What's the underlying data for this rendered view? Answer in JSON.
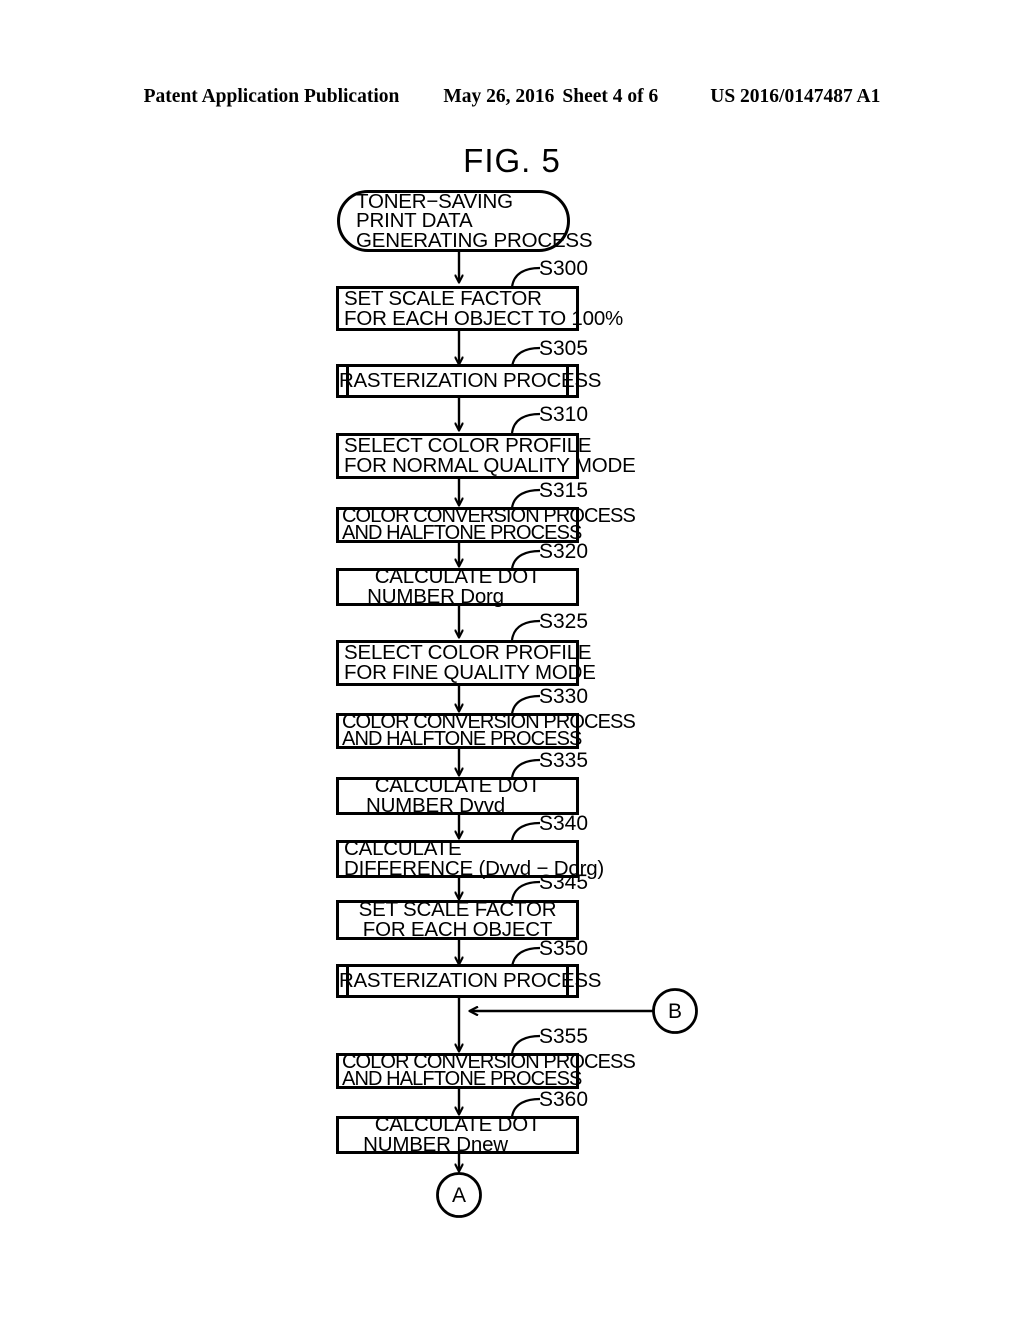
{
  "header": {
    "publication": "Patent Application Publication",
    "date": "May 26, 2016",
    "sheet": "Sheet 4 of 6",
    "patent_number": "US 2016/0147487 A1"
  },
  "figure": {
    "title": "FIG. 5"
  },
  "flowchart": {
    "start": {
      "label": "toner-saving-print-data-generating-process",
      "lines": [
        "TONER−SAVING",
        "PRINT DATA",
        "GENERATING PROCESS"
      ]
    },
    "steps": [
      {
        "id": "S300",
        "shape": "process",
        "align": "left",
        "lines": [
          "SET SCALE FACTOR",
          "FOR EACH OBJECT TO 100%"
        ]
      },
      {
        "id": "S305",
        "shape": "predefined-process",
        "align": "center",
        "lines": [
          "RASTERIZATION PROCESS"
        ]
      },
      {
        "id": "S310",
        "shape": "process",
        "align": "left",
        "lines": [
          "SELECT COLOR PROFILE",
          "FOR NORMAL QUALITY MODE"
        ]
      },
      {
        "id": "S315",
        "shape": "process-tight",
        "align": "left",
        "lines": [
          "COLOR CONVERSION PROCESS",
          "AND HALFTONE PROCESS"
        ]
      },
      {
        "id": "S320",
        "shape": "process",
        "align": "center",
        "lines": [
          "CALCULATE DOT",
          "NUMBER Dorg"
        ]
      },
      {
        "id": "S325",
        "shape": "process",
        "align": "left",
        "lines": [
          "SELECT COLOR PROFILE",
          "FOR FINE QUALITY MODE"
        ]
      },
      {
        "id": "S330",
        "shape": "process-tight",
        "align": "left",
        "lines": [
          "COLOR CONVERSION PROCESS",
          "AND HALFTONE PROCESS"
        ]
      },
      {
        "id": "S335",
        "shape": "process",
        "align": "center",
        "lines": [
          "CALCULATE DOT",
          "NUMBER Dvvd"
        ]
      },
      {
        "id": "S340",
        "shape": "process",
        "align": "left",
        "lines": [
          "CALCULATE",
          "DIFFERENCE (Dvvd − Dorg)"
        ]
      },
      {
        "id": "S345",
        "shape": "process",
        "align": "center",
        "lines": [
          "SET SCALE FACTOR",
          "FOR EACH OBJECT"
        ]
      },
      {
        "id": "S350",
        "shape": "predefined-process",
        "align": "center",
        "lines": [
          "RASTERIZATION PROCESS"
        ]
      },
      {
        "id": "S355",
        "shape": "process-tight",
        "align": "left",
        "lines": [
          "COLOR CONVERSION PROCESS",
          "AND HALFTONE PROCESS"
        ]
      },
      {
        "id": "S360",
        "shape": "process",
        "align": "center",
        "lines": [
          "CALCULATE DOT",
          "NUMBER Dnew"
        ]
      }
    ],
    "connectors": [
      {
        "label": "B",
        "direction": "in",
        "position": "right-of-S350"
      },
      {
        "label": "A",
        "direction": "out",
        "position": "below-S360"
      }
    ]
  }
}
